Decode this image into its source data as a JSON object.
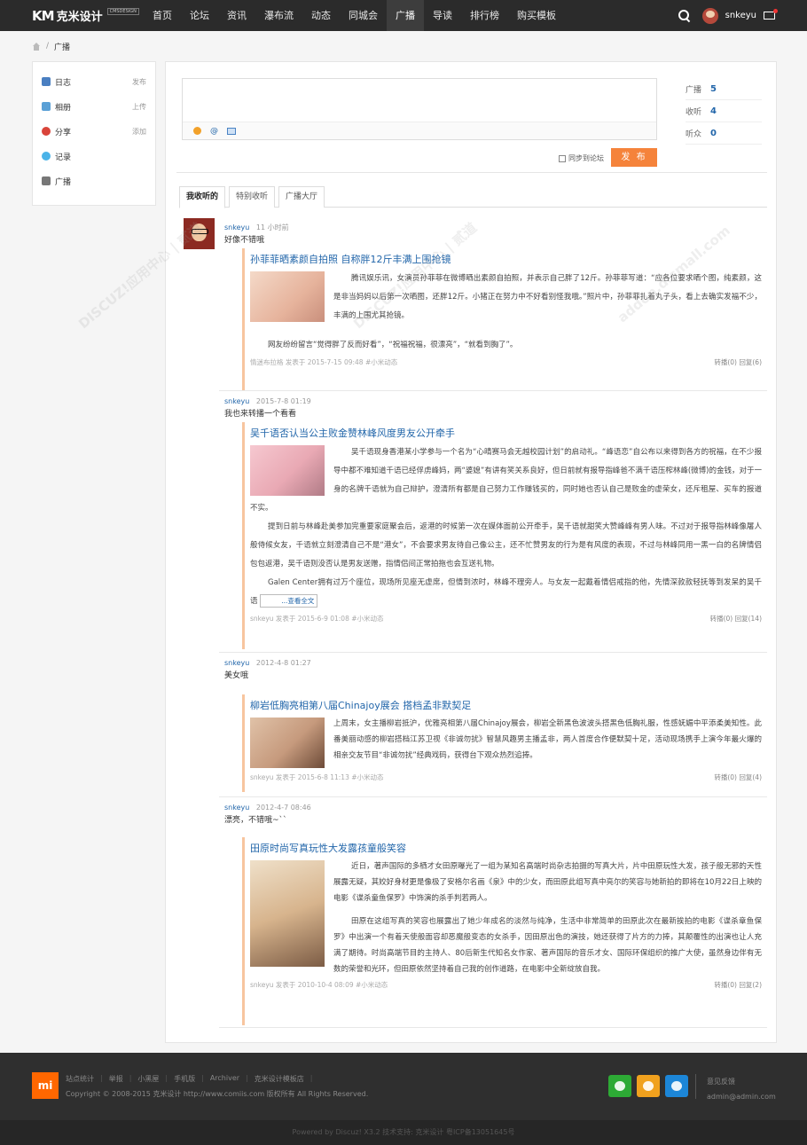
{
  "brand": {
    "mark": "KM",
    "name": "克米设计",
    "badge": "CMSDESIGN"
  },
  "nav": {
    "items": [
      "首页",
      "论坛",
      "资讯",
      "瀑布流",
      "动态",
      "同城会",
      "广播",
      "导读",
      "排行榜",
      "购买模板"
    ],
    "active": "广播",
    "user": "snkeyu"
  },
  "breadcrumb": {
    "current": "广播"
  },
  "leftmenu": [
    {
      "label": "日志",
      "action": "发布",
      "color": "#4a7fc1"
    },
    {
      "label": "相册",
      "action": "上传",
      "color": "#5aa0d6"
    },
    {
      "label": "分享",
      "action": "添加",
      "color": "#d9443a"
    },
    {
      "label": "记录",
      "action": "",
      "color": "#4bb3e8"
    },
    {
      "label": "广播",
      "action": "",
      "color": "#777777"
    }
  ],
  "composer": {
    "at": "@",
    "sync_label": "同步到论坛",
    "publish_label": "发 布"
  },
  "stats": [
    {
      "label": "广播",
      "value": "5"
    },
    {
      "label": "收听",
      "value": "4"
    },
    {
      "label": "听众",
      "value": "0"
    }
  ],
  "tabs": [
    "我收听的",
    "特别收听",
    "广播大厅"
  ],
  "posts": [
    {
      "user": "snkeyu",
      "time": "11 小时前",
      "text": "好像不错哦",
      "quote": {
        "title": "孙菲菲晒素颜自拍照 自称胖12斤丰满上围抢镜",
        "body": "腾讯娱乐讯，女演员孙菲菲在微博晒出素颜自拍照，并表示自己胖了12斤。孙菲菲写道：“应各位要求晒个图，纯素颜，这是非当妈妈以后第一次晒图，还胖12斤。小猪正在努力中不好看别怪我哦。”照片中，孙菲菲扎着丸子头，看上去确实发福不少，丰满的上围尤其抢镜。",
        "body2": "网友纷纷留言“觉得胖了反而好看”，“祝福祝福，很漂亮”，“就看到胸了”。",
        "footer": "情迷布拉格 发表于 2015-7-15 09:48 #小米动态",
        "acts": "转播(0)  回复(6)",
        "img": "#e6b39c"
      }
    },
    {
      "user": "snkeyu",
      "time": "2015-7-8 01:19",
      "text": "我也来转播一个看看",
      "quote": {
        "title": "吴千语否认当公主败金赞林峰风度男友公开牵手",
        "body": "吴千语现身香港某小学参与一个名为“心晴赛马会无越校园计划”的启动礼。“峰语恋”自公布以来得到各方的祝福，在不少报导中都不难知道千语已经俘虏峰妈，两“婆媳”有讲有笑关系良好，但日前就有报导指峰爸不满千语压榨林峰(微博)的金钱，对于一身的名牌千语就为自己辩护，澄清所有都是自己努力工作赚钱买的，同时她也否认自己是败金的虚荣女，还斥租屋、买车的报道不实。",
        "body2": "提到日前与林峰赴美参加完重要家庭聚会后，返港的时候第一次在媒体面前公开牵手，吴千语就甜笑大赞峰峰有男人味。不过对于报导指林峰像屠人般侍候女友，千语就立刻澄清自己不是“港女”，不会要求男友待自己像公主，还不忙赞男友的行为是有风度的表现，不过与林峰同用一黑一白的名牌情侣包包返港，吴千语则没否认是男友送赠，指情侣间正常拍拖也会互送礼物。",
        "body3": "Galen Center拥有过万个座位，现场所见座无虚席，但情到浓时，林峰不理旁人。与女友一起戴着情侣戒指的他，先情深款款轻抚等到发呆的吴千语",
        "more": "...查看全文",
        "footer": "snkeyu 发表于 2015-6-9 01:08 #小米动态",
        "acts": "转播(0)  回复(14)",
        "img": "#e9a9b4"
      }
    },
    {
      "user": "snkeyu",
      "time": "2012-4-8 01:27",
      "text": "美女哦",
      "quote": {
        "title": "柳岩低胸亮相第八届Chinajoy展会 搭档孟非默契足",
        "body": "上周末，女主播柳岩抵沪，优雅亮相第八届Chinajoy展会，柳岩全新黑色波波头搭黑色低胸礼服，性感妩媚中平添柔美知性。此番美丽动感的柳岩搭档江苏卫视《非诚勿扰》智慧风趣男主播孟非，两人首度合作便默契十足，活动现场携手上演今年最火爆的相亲交友节目“非诚勿扰”经典戏码，获得台下观众热烈追捧。",
        "footer": "snkeyu 发表于 2015-6-8 11:13 #小米动态",
        "acts": "转播(0)  回复(4)",
        "img": "#c69a7d"
      }
    },
    {
      "user": "snkeyu",
      "time": "2012-4-7 08:46",
      "text": "漂亮，不错哦~``",
      "quote": {
        "title": "田原时尚写真玩性大发露孩童般笑容",
        "body": "近日，著声国际的多栖才女田原曝光了一组为某知名高端时尚杂志拍摄的写真大片，片中田原玩性大发，孩子般无邪的天性展露无疑，其姣好身材更是像极了安格尔名画《泉》中的少女，而田原此组写真中亮尔的笑容与她新拍的即将在10月22日上映的电影《谍杀童鱼保罗》中饰演的杀手判若两人。",
        "body2": "田原在这组写真的笑容也展露出了她少年成名的淡然与纯净，生活中非常简单的田原此次在最新挨拍的电影《谍杀章鱼保罗》中出演一个有着天使般面容却恶魔般变态的女杀手，因田原出色的演技，她还获得了片方的力捧，其颠覆性的出演也让人充满了期待。时尚高端节目的主持人、80后新生代知名女作家、著声国际的音乐才女、国际环保组织的推广大使，虽然身边伴有无数的荣誉和光环，但田原依然坚持着自己我的创作道路，在电影中全新绽放自我。",
        "footer": "snkeyu 发表于 2010-10-4 08:09 #小米动态",
        "acts": "转播(0)  回复(2)",
        "img": "#d7b48d"
      }
    }
  ],
  "footer": {
    "links": [
      "站点统计",
      "举报",
      "小黑屋",
      "手机版",
      "Archiver",
      "克米设计模板店"
    ],
    "copyright": "Copyright © 2008-2015 克米设计 http://www.comiis.com 版权所有 All Rights Reserved.",
    "feedback": "意见反馈",
    "email": "admin@admin.com",
    "mi": "mi",
    "powered": "Powered by Discuz! X3.2  技术支持: 克米设计  粤ICP备13051645号"
  },
  "watermark": {
    "text": "DISCUZ!应用中心 | 贰道",
    "sub": "addon.dismall.com"
  },
  "colors": {
    "accent": "#2266aa",
    "publish": "#f5833b",
    "nav_bg": "#2b2b2b",
    "quote_border": "#f7c59f"
  }
}
